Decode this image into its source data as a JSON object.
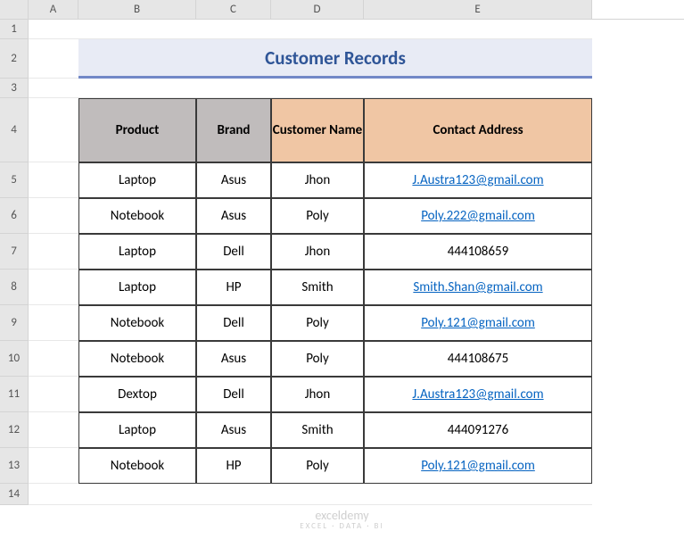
{
  "columns": {
    "A": "A",
    "B": "B",
    "C": "C",
    "D": "D",
    "E": "E"
  },
  "rowNums": [
    "1",
    "2",
    "3",
    "4",
    "5",
    "6",
    "7",
    "8",
    "9",
    "10",
    "11",
    "12",
    "13",
    "14"
  ],
  "title": "Customer Records",
  "headers": {
    "product": "Product",
    "brand": "Brand",
    "customer": "Customer Name",
    "contact": "Contact Address"
  },
  "rows": [
    {
      "product": "Laptop",
      "brand": "Asus",
      "customer": "Jhon",
      "contact": "J.Austra123@gmail.com",
      "link": true
    },
    {
      "product": "Notebook",
      "brand": "Asus",
      "customer": "Poly",
      "contact": "Poly.222@gmail.com",
      "link": true
    },
    {
      "product": "Laptop",
      "brand": "Dell",
      "customer": "Jhon",
      "contact": "444108659",
      "link": false
    },
    {
      "product": "Laptop",
      "brand": "HP",
      "customer": "Smith",
      "contact": "Smith.Shan@gmail.com",
      "link": true
    },
    {
      "product": "Notebook",
      "brand": "Dell",
      "customer": "Poly",
      "contact": "Poly.121@gmail.com",
      "link": true
    },
    {
      "product": "Notebook",
      "brand": "Asus",
      "customer": "Poly",
      "contact": "444108675",
      "link": false
    },
    {
      "product": "Dextop",
      "brand": "Dell",
      "customer": "Jhon",
      "contact": "J.Austra123@gmail.com",
      "link": true
    },
    {
      "product": "Laptop",
      "brand": "Asus",
      "customer": "Smith",
      "contact": "444091276",
      "link": false
    },
    {
      "product": "Notebook",
      "brand": "HP",
      "customer": "Poly",
      "contact": "Poly.121@gmail.com",
      "link": true
    }
  ],
  "watermark": {
    "main": "exceldemy",
    "sub": "EXCEL · DATA · BI"
  }
}
